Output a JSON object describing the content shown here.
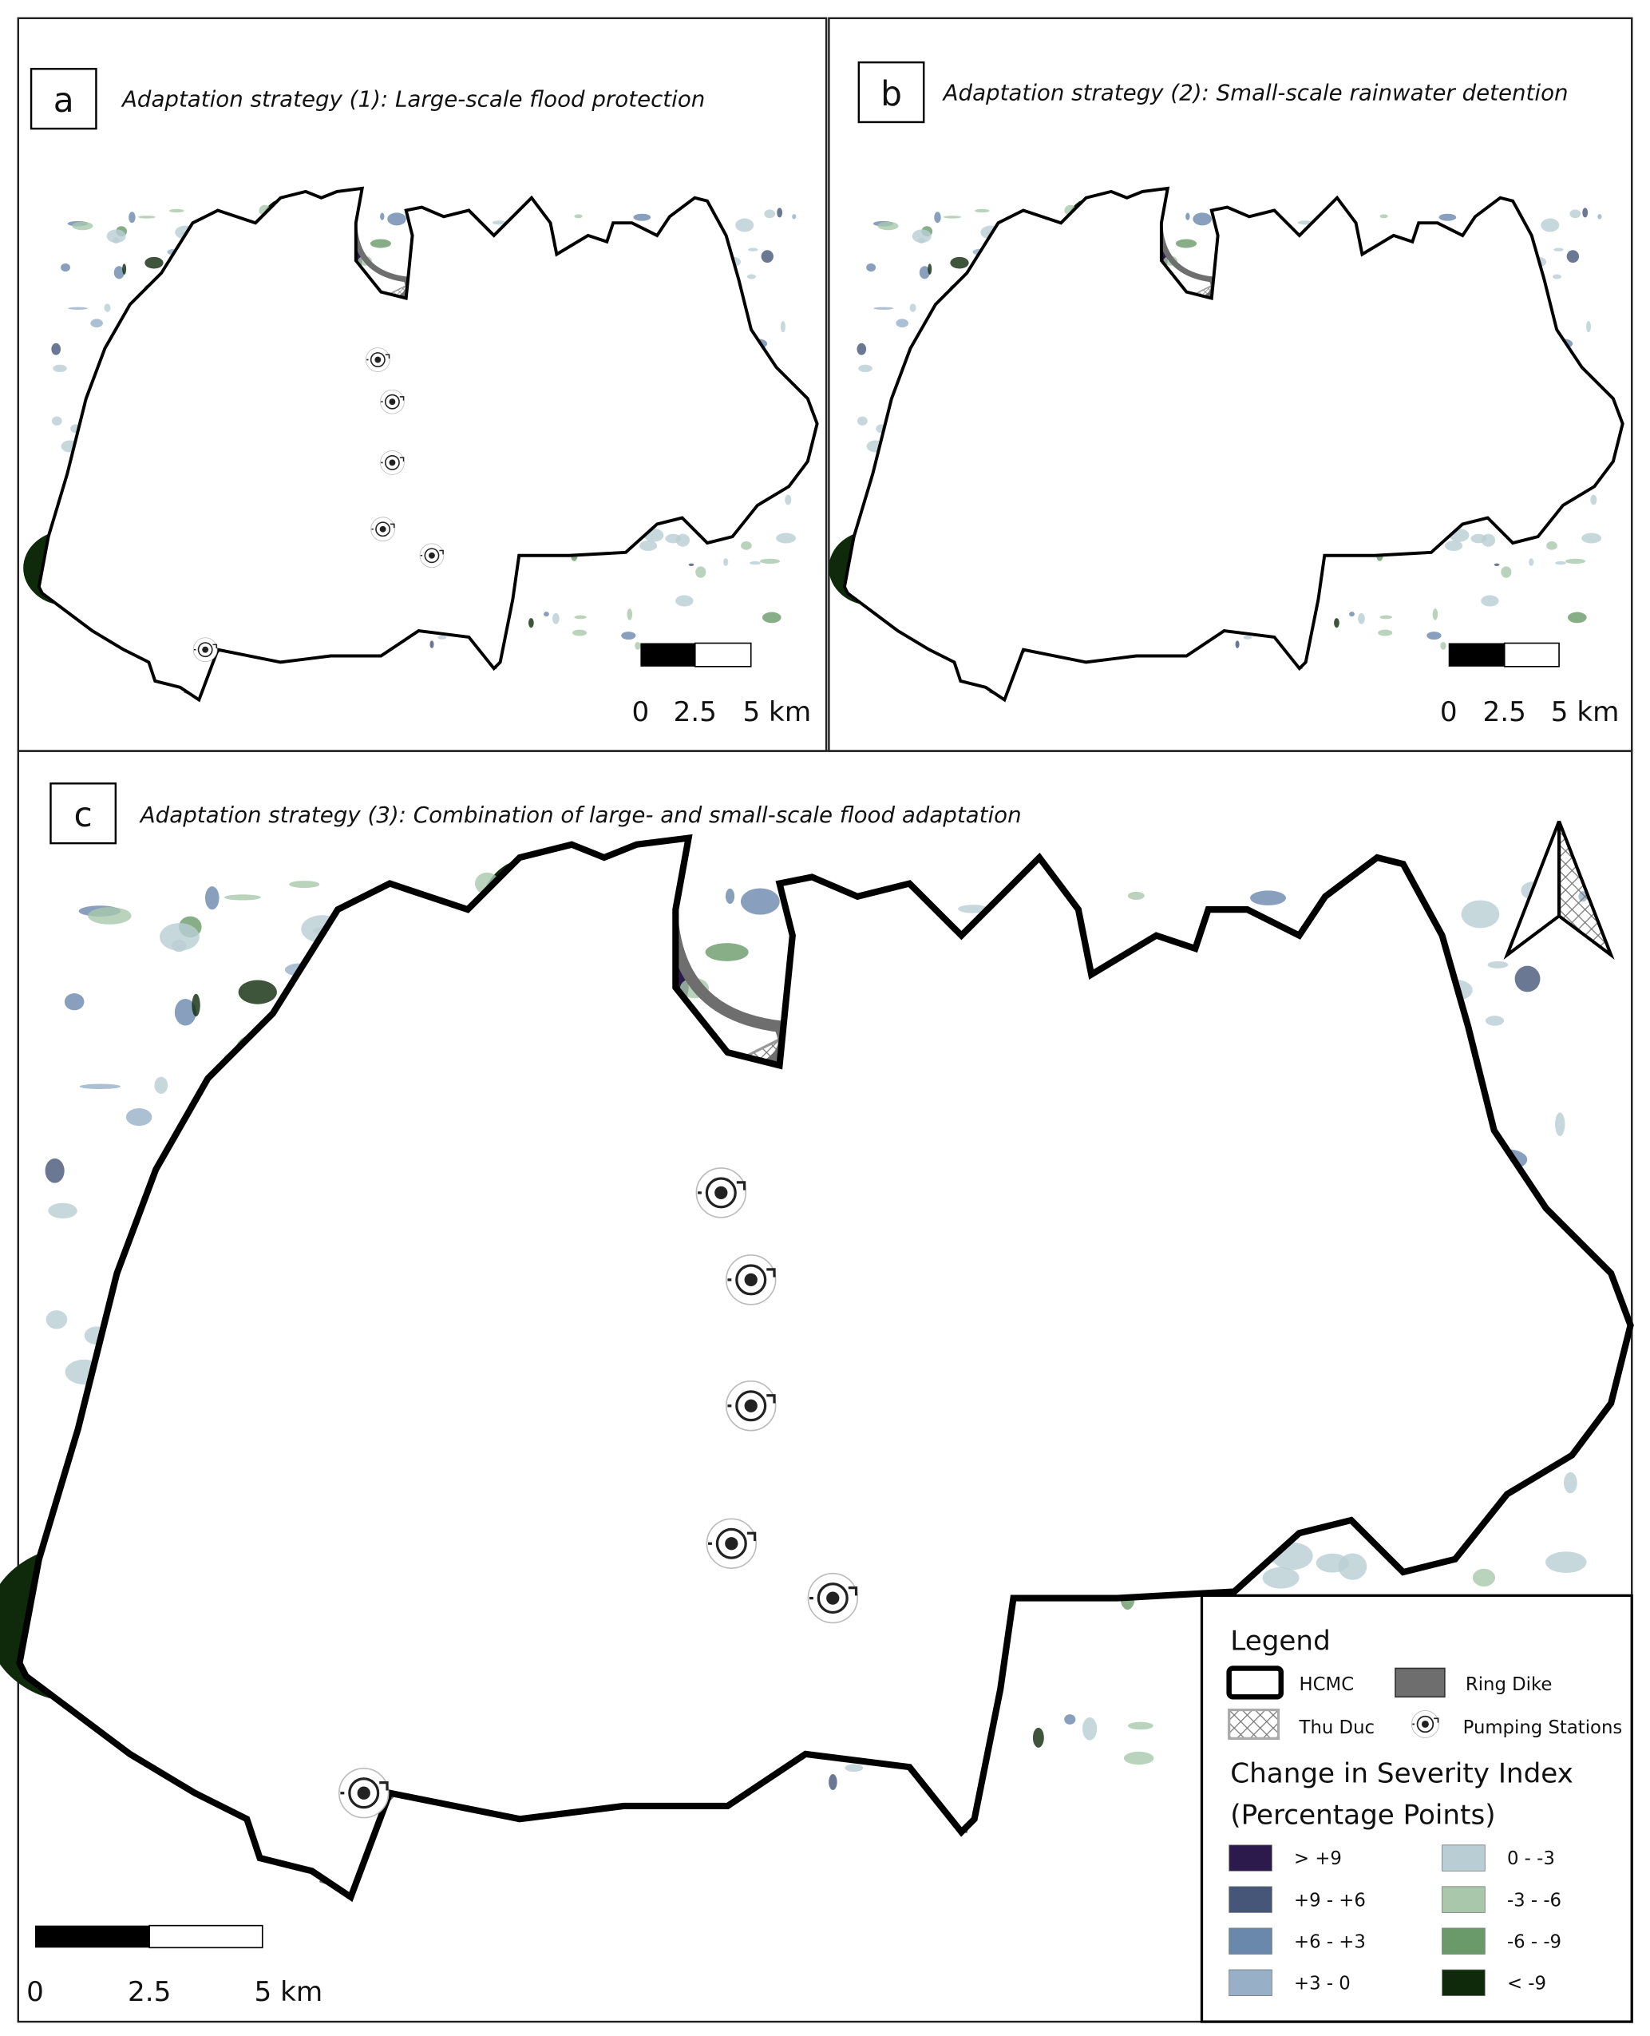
{
  "panels": [
    {
      "letter": "a",
      "title": "Adaptation strategy (1): Large-scale flood protection",
      "scale_labels": [
        "0",
        "2.5",
        "5 km"
      ]
    },
    {
      "letter": "b",
      "title": "Adaptation strategy (2): Small-scale rainwater detention",
      "scale_labels": [
        "0",
        "2.5",
        "5 km"
      ]
    },
    {
      "letter": "c",
      "title": "Adaptation strategy (3): Combination of large- and small-scale flood adaptation",
      "scale_labels": [
        "0",
        "2.5",
        "5 km"
      ]
    }
  ],
  "legend": {
    "title": "Legend",
    "features": [
      {
        "label": "HCMC",
        "icon": "thick-outline-box"
      },
      {
        "label": "Ring Dike",
        "icon": "grey-filled-box",
        "color": "#6e6e6e"
      },
      {
        "label": "Thu Duc",
        "icon": "crosshatch-box"
      },
      {
        "label": "Pumping Stations",
        "icon": "pump-icon"
      }
    ],
    "index_title_1": "Change in Severity Index",
    "index_title_2": "(Percentage Points)",
    "classes": [
      {
        "label": "> +9",
        "color": "#2b1a4b"
      },
      {
        "label": "+9 - +6",
        "color": "#465679"
      },
      {
        "label": "+6 - +3",
        "color": "#6a88ac"
      },
      {
        "label": "+3 - 0",
        "color": "#97b0c8"
      },
      {
        "label": "0 - -3",
        "color": "#b9ced4"
      },
      {
        "label": "-3 - -6",
        "color": "#a9c8ab"
      },
      {
        "label": "-6 - -9",
        "color": "#6a9a6a"
      },
      {
        "label": "< -9",
        "color": "#0e2a0a"
      }
    ]
  },
  "north_arrow": "north-arrow-icon"
}
